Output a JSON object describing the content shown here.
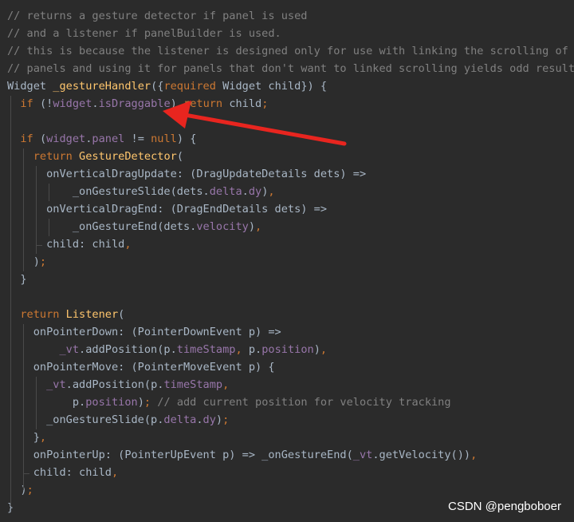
{
  "colors": {
    "background": "#2b2b2b",
    "comment": "#808080",
    "keyword": "#cc7832",
    "function": "#ffc66d",
    "field": "#9876aa",
    "plain": "#a9b7c6",
    "indent_guide": "#4a4a4a",
    "annotation_arrow": "#e8251f",
    "watermark": "#ffffff"
  },
  "annotation": {
    "icon": "red-arrow-icon"
  },
  "watermark": "CSDN @pengboboer",
  "code_lines": [
    [
      {
        "t": "// returns a gesture detector if panel is used",
        "c": "comment"
      }
    ],
    [
      {
        "t": "// and a listener if panelBuilder is used.",
        "c": "comment"
      }
    ],
    [
      {
        "t": "// this is because the listener is designed only for use with linking the scrolling of",
        "c": "comment"
      }
    ],
    [
      {
        "t": "// panels and using it for panels that don't want to linked scrolling yields odd results",
        "c": "comment"
      }
    ],
    [
      {
        "t": "Widget ",
        "c": "plain"
      },
      {
        "t": "_gestureHandler",
        "c": "function"
      },
      {
        "t": "({",
        "c": "plain"
      },
      {
        "t": "required ",
        "c": "keyword"
      },
      {
        "t": "Widget child}) {",
        "c": "plain"
      }
    ],
    [
      {
        "t": "  ",
        "c": "plain"
      },
      {
        "t": "if ",
        "c": "keyword"
      },
      {
        "t": "(!",
        "c": "plain"
      },
      {
        "t": "widget",
        "c": "field"
      },
      {
        "t": ".",
        "c": "plain"
      },
      {
        "t": "isDraggable",
        "c": "field"
      },
      {
        "t": ") ",
        "c": "plain"
      },
      {
        "t": "return ",
        "c": "keyword"
      },
      {
        "t": "child",
        "c": "plain"
      },
      {
        "t": ";",
        "c": "keyword"
      }
    ],
    [],
    [
      {
        "t": "  ",
        "c": "plain"
      },
      {
        "t": "if ",
        "c": "keyword"
      },
      {
        "t": "(",
        "c": "plain"
      },
      {
        "t": "widget",
        "c": "field"
      },
      {
        "t": ".",
        "c": "plain"
      },
      {
        "t": "panel",
        "c": "field"
      },
      {
        "t": " != ",
        "c": "plain"
      },
      {
        "t": "null",
        "c": "keyword"
      },
      {
        "t": ") {",
        "c": "plain"
      }
    ],
    [
      {
        "t": "    ",
        "c": "plain"
      },
      {
        "t": "return ",
        "c": "keyword"
      },
      {
        "t": "GestureDetector",
        "c": "function"
      },
      {
        "t": "(",
        "c": "plain"
      }
    ],
    [
      {
        "t": "      onVerticalDragUpdate: (DragUpdateDetails dets) =>",
        "c": "plain"
      }
    ],
    [
      {
        "t": "          _onGestureSlide(dets.",
        "c": "plain"
      },
      {
        "t": "delta",
        "c": "field"
      },
      {
        "t": ".",
        "c": "plain"
      },
      {
        "t": "dy",
        "c": "field"
      },
      {
        "t": ")",
        "c": "plain"
      },
      {
        "t": ",",
        "c": "keyword"
      }
    ],
    [
      {
        "t": "      onVerticalDragEnd: (DragEndDetails dets) =>",
        "c": "plain"
      }
    ],
    [
      {
        "t": "          _onGestureEnd(dets.",
        "c": "plain"
      },
      {
        "t": "velocity",
        "c": "field"
      },
      {
        "t": ")",
        "c": "plain"
      },
      {
        "t": ",",
        "c": "keyword"
      }
    ],
    [
      {
        "t": "      child: child",
        "c": "plain"
      },
      {
        "t": ",",
        "c": "keyword"
      }
    ],
    [
      {
        "t": "    )",
        "c": "plain"
      },
      {
        "t": ";",
        "c": "keyword"
      }
    ],
    [
      {
        "t": "  }",
        "c": "plain"
      }
    ],
    [],
    [
      {
        "t": "  ",
        "c": "plain"
      },
      {
        "t": "return ",
        "c": "keyword"
      },
      {
        "t": "Listener",
        "c": "function"
      },
      {
        "t": "(",
        "c": "plain"
      }
    ],
    [
      {
        "t": "    onPointerDown: (PointerDownEvent p) =>",
        "c": "plain"
      }
    ],
    [
      {
        "t": "        _vt",
        "c": "field"
      },
      {
        "t": ".addPosition(p.",
        "c": "plain"
      },
      {
        "t": "timeStamp",
        "c": "field"
      },
      {
        "t": ", ",
        "c": "keyword"
      },
      {
        "t": "p.",
        "c": "plain"
      },
      {
        "t": "position",
        "c": "field"
      },
      {
        "t": ")",
        "c": "plain"
      },
      {
        "t": ",",
        "c": "keyword"
      }
    ],
    [
      {
        "t": "    onPointerMove: (PointerMoveEvent p) {",
        "c": "plain"
      }
    ],
    [
      {
        "t": "      ",
        "c": "plain"
      },
      {
        "t": "_vt",
        "c": "field"
      },
      {
        "t": ".addPosition(p.",
        "c": "plain"
      },
      {
        "t": "timeStamp",
        "c": "field"
      },
      {
        "t": ",",
        "c": "keyword"
      }
    ],
    [
      {
        "t": "          p.",
        "c": "plain"
      },
      {
        "t": "position",
        "c": "field"
      },
      {
        "t": ")",
        "c": "plain"
      },
      {
        "t": "; ",
        "c": "keyword"
      },
      {
        "t": "// add current position for velocity tracking",
        "c": "comment"
      }
    ],
    [
      {
        "t": "      _onGestureSlide(p.",
        "c": "plain"
      },
      {
        "t": "delta",
        "c": "field"
      },
      {
        "t": ".",
        "c": "plain"
      },
      {
        "t": "dy",
        "c": "field"
      },
      {
        "t": ")",
        "c": "plain"
      },
      {
        "t": ";",
        "c": "keyword"
      }
    ],
    [
      {
        "t": "    }",
        "c": "plain"
      },
      {
        "t": ",",
        "c": "keyword"
      }
    ],
    [
      {
        "t": "    onPointerUp: (PointerUpEvent p) => _onGestureEnd(",
        "c": "plain"
      },
      {
        "t": "_vt",
        "c": "field"
      },
      {
        "t": ".getVelocity())",
        "c": "plain"
      },
      {
        "t": ",",
        "c": "keyword"
      }
    ],
    [
      {
        "t": "    child: child",
        "c": "plain"
      },
      {
        "t": ",",
        "c": "keyword"
      }
    ],
    [
      {
        "t": "  )",
        "c": "plain"
      },
      {
        "t": ";",
        "c": "keyword"
      }
    ],
    [
      {
        "t": "}",
        "c": "plain"
      }
    ]
  ]
}
